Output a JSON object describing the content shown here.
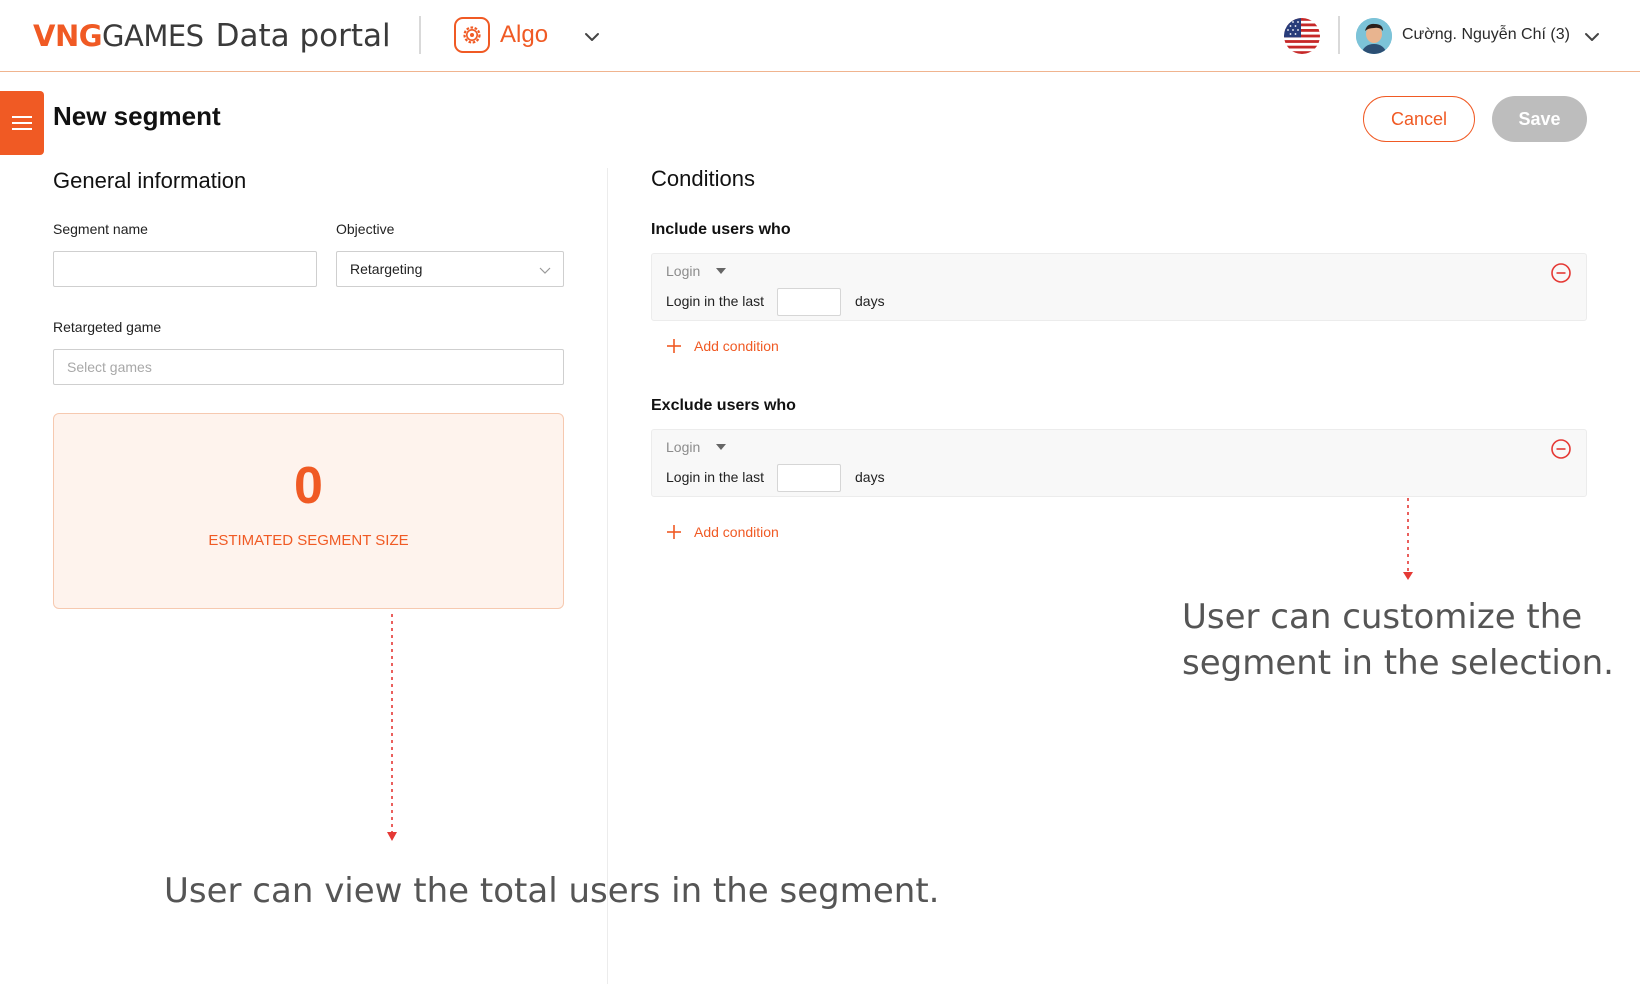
{
  "header": {
    "brand_vng": "VNG",
    "brand_games": "GAMES",
    "brand_portal": "Data portal",
    "app_name": "Algo",
    "user_name": "Cường. Nguyễn Chí (3)"
  },
  "page": {
    "title": "New segment",
    "cancel_label": "Cancel",
    "save_label": "Save"
  },
  "general": {
    "title": "General information",
    "segment_name_label": "Segment name",
    "segment_name_value": "",
    "objective_label": "Objective",
    "objective_value": "Retargeting",
    "retargeted_game_label": "Retargeted game",
    "retargeted_game_placeholder": "Select games",
    "estimate_value": "0",
    "estimate_label": "ESTIMATED SEGMENT SIZE"
  },
  "conditions": {
    "title": "Conditions",
    "include": {
      "title": "Include users who",
      "event": "Login",
      "prefix": "Login in the last",
      "days_value": "",
      "suffix": "days",
      "add_label": "Add condition"
    },
    "exclude": {
      "title": "Exclude users who",
      "event": "Login",
      "prefix": "Login in the last",
      "days_value": "",
      "suffix": "days",
      "add_label": "Add condition"
    }
  },
  "annotations": {
    "customize_line1": "User can customize the",
    "customize_line2": "segment in the selection.",
    "total_users": "User can view the total users in the segment."
  },
  "colors": {
    "accent": "#f05a24",
    "estimate_bg": "#fef3ed",
    "save_disabled": "#bdbdbd",
    "annotation_arrow": "#e53935"
  },
  "icons": [
    "algo-gear-icon",
    "chevron-down-icon",
    "us-flag-icon",
    "avatar",
    "hamburger-icon",
    "remove-circle-icon",
    "plus-icon"
  ]
}
